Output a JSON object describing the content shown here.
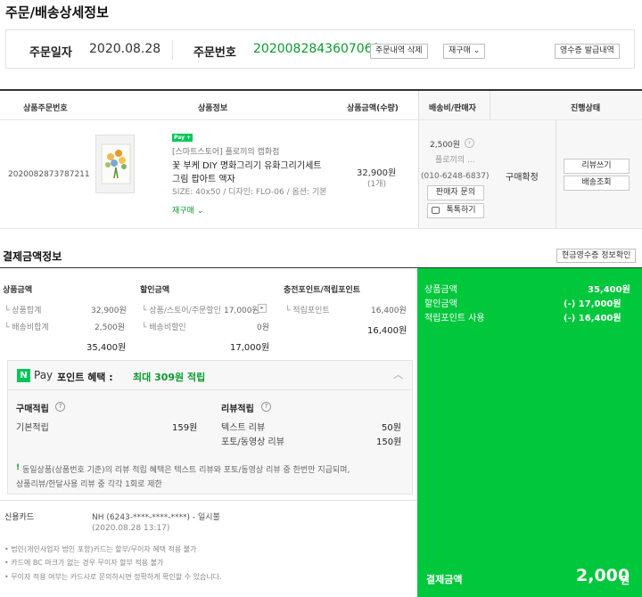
{
  "page_title": "주문/배송상세정보",
  "order": {
    "date_label": "주문일자",
    "date": "2020.08.28",
    "number_label": "주문번호",
    "number": "2020082843607061",
    "delete_btn": "주문내역 삭제",
    "reorder_btn": "재구매 ⌄",
    "receipt_btn": "영수증 발급내역"
  },
  "table": {
    "headers": [
      "상품주문번호",
      "상품정보",
      "상품금액(수량)",
      "배송비/판매자",
      "진행상태"
    ],
    "row": {
      "product_order_no": "2020082873787211",
      "pay_badge": "Pay +",
      "store": "[스마트스토어] 플로끼의 캡화점",
      "product_name_1": "꽃 부케 DIY 명화그리기 유화그리기세트",
      "product_name_2": "그림 팝아트 액자",
      "option": "SIZE: 40x50 / 디자인: FLO-06 / 옵션: 기본",
      "rebuy": "재구매 ⌄",
      "price": "32,900원",
      "qty": "(1개)",
      "shipping_fee": "2,500원",
      "seller": "플로끼의 ...",
      "phone": "(010-6248-6837)",
      "seller_inquiry_btn": "판매자 문의",
      "talk_btn": "톡톡하기",
      "status": "구매확정",
      "review_btn": "리뷰쓰기",
      "tracking_btn": "배송조회"
    }
  },
  "payment": {
    "section_title": "결제금액정보",
    "cash_receipt_btn": "현금영수증 정보확인",
    "col1_title": "상품금액",
    "col1_rows": [
      {
        "label": "└ 상품합계",
        "value": "32,900원"
      },
      {
        "label": "└ 배송비합계",
        "value": "2,500원"
      }
    ],
    "col1_total": "35,400원",
    "col2_title": "할인금액",
    "col2_rows": [
      {
        "label": "└ 상품/스토어/주문할인",
        "value": "17,000원"
      },
      {
        "label": "└ 배송비할인",
        "value": "0원"
      }
    ],
    "col2_total": "17,000원",
    "col3_title": "충전포인트/적립포인트",
    "col3_rows": [
      {
        "label": "└ 적립포인트",
        "value": "16,400원"
      }
    ],
    "col3_total": "16,400원",
    "summary": [
      {
        "label": "상품금액",
        "value": "35,400원"
      },
      {
        "label": "할인금액",
        "value": "(-) 17,000원"
      },
      {
        "label": "적립포인트 사용",
        "value": "(-) 16,400원"
      }
    ],
    "final_label": "결제금액",
    "final_amount": "2,000",
    "final_unit": "원"
  },
  "npay": {
    "badge": "N",
    "pay_text": "Pay",
    "title": "포인트 혜택 :",
    "highlight": "최대 309원 적립",
    "purchase_title": "구매적립",
    "basic_label": "기본적립",
    "basic_value": "159원",
    "review_title": "리뷰적립",
    "text_review_label": "텍스트 리뷰",
    "text_review_value": "50원",
    "photo_review_label": "포토/동영상 리뷰",
    "photo_review_value": "150원",
    "notice_1": "동일상품(상품번호 기준)의 리뷰 적립 혜택은 텍스트 리뷰와 포토/동영상 리뷰 중 한번만 지급되며,",
    "notice_2": "상품리뷰/한달사용 리뷰 중 각각 1회로 제한"
  },
  "card": {
    "label": "신용카드",
    "info": "NH (6243-****-****-****) - 일시불",
    "datetime": "(2020.08.28 13:17)",
    "notes": [
      "• 법인(개인사업자 법인 포함)카드는 할부/무이자 혜택 적용 불가",
      "• 카드에 BC 마크가 없는 경우 무이자 할부 적용 불가",
      "• 무이자 적용 여부는 카드사로 문의하시면 정확하게 확인할 수 있습니다."
    ]
  },
  "colors": {
    "green": "#00c73c",
    "order_no_green": "#0b9a2e",
    "npay": "#03c75a"
  }
}
